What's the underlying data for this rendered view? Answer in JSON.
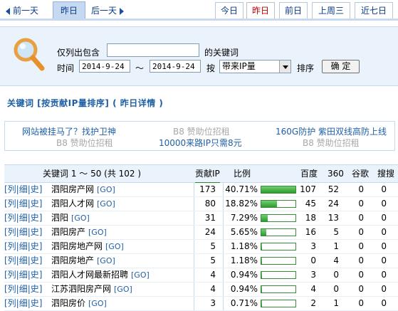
{
  "nav": {
    "prev": "前一天",
    "current": "昨日",
    "next": "后一天",
    "tabs": [
      "今日",
      "昨日",
      "前日",
      "上周三",
      "近七日"
    ],
    "active_tab": "昨日"
  },
  "filter": {
    "only_list_label": "仅列出包含",
    "keyword_suffix": "的关键词",
    "time_label": "时间",
    "date_from": "2014-9-24",
    "range_sep": "～",
    "date_to": "2014-9-24",
    "by_label": "按",
    "sort_select": "带来IP量",
    "sort_label": "排序",
    "confirm_btn": "确 定"
  },
  "section_title": "关键词 [按贡献IP量排序] ( 昨日详情 )",
  "ads": {
    "row1": [
      "网站被挂马了？找护卫神",
      "B8 赞助位招租",
      "160G防护 紫田双线高防上线"
    ],
    "row2": [
      "B8 赞助位招租",
      "10000来路IP只需8元",
      "B8 赞助位招租"
    ]
  },
  "table": {
    "headers": {
      "keyword": "关键词 1 ～ 50 (共 102 )",
      "contrib_ip": "贡献IP",
      "ratio": "比例",
      "baidu": "百度",
      "s360": "360",
      "google": "谷歌",
      "sogou": "搜搜"
    },
    "link_text": "[列|细|史]",
    "go_text": "[GO]",
    "rows": [
      {
        "keyword": "泗阳房产网",
        "ip": "173",
        "ratio": "40.71%",
        "pct": 40.71,
        "baidu": "107",
        "s360": "52",
        "google": "0",
        "sogou": "0"
      },
      {
        "keyword": "泗阳人才网",
        "ip": "80",
        "ratio": "18.82%",
        "pct": 18.82,
        "baidu": "45",
        "s360": "24",
        "google": "0",
        "sogou": "0"
      },
      {
        "keyword": "泗阳",
        "ip": "31",
        "ratio": "7.29%",
        "pct": 7.29,
        "baidu": "18",
        "s360": "13",
        "google": "0",
        "sogou": "0"
      },
      {
        "keyword": "泗阳房产",
        "ip": "24",
        "ratio": "5.65%",
        "pct": 5.65,
        "baidu": "16",
        "s360": "5",
        "google": "0",
        "sogou": "0"
      },
      {
        "keyword": "泗阳房地产网",
        "ip": "5",
        "ratio": "1.18%",
        "pct": 1.18,
        "baidu": "3",
        "s360": "1",
        "google": "0",
        "sogou": "0"
      },
      {
        "keyword": "泗阳房地产",
        "ip": "5",
        "ratio": "1.18%",
        "pct": 1.18,
        "baidu": "0",
        "s360": "4",
        "google": "0",
        "sogou": "0"
      },
      {
        "keyword": "泗阳人才网最新招聘",
        "ip": "4",
        "ratio": "0.94%",
        "pct": 0.94,
        "baidu": "3",
        "s360": "0",
        "google": "0",
        "sogou": "0"
      },
      {
        "keyword": "江苏泗阳房产网",
        "ip": "4",
        "ratio": "0.94%",
        "pct": 0.94,
        "baidu": "4",
        "s360": "0",
        "google": "0",
        "sogou": "0"
      },
      {
        "keyword": "泗阳房价",
        "ip": "3",
        "ratio": "0.71%",
        "pct": 0.71,
        "baidu": "2",
        "s360": "1",
        "google": "0",
        "sogou": "0"
      }
    ]
  }
}
